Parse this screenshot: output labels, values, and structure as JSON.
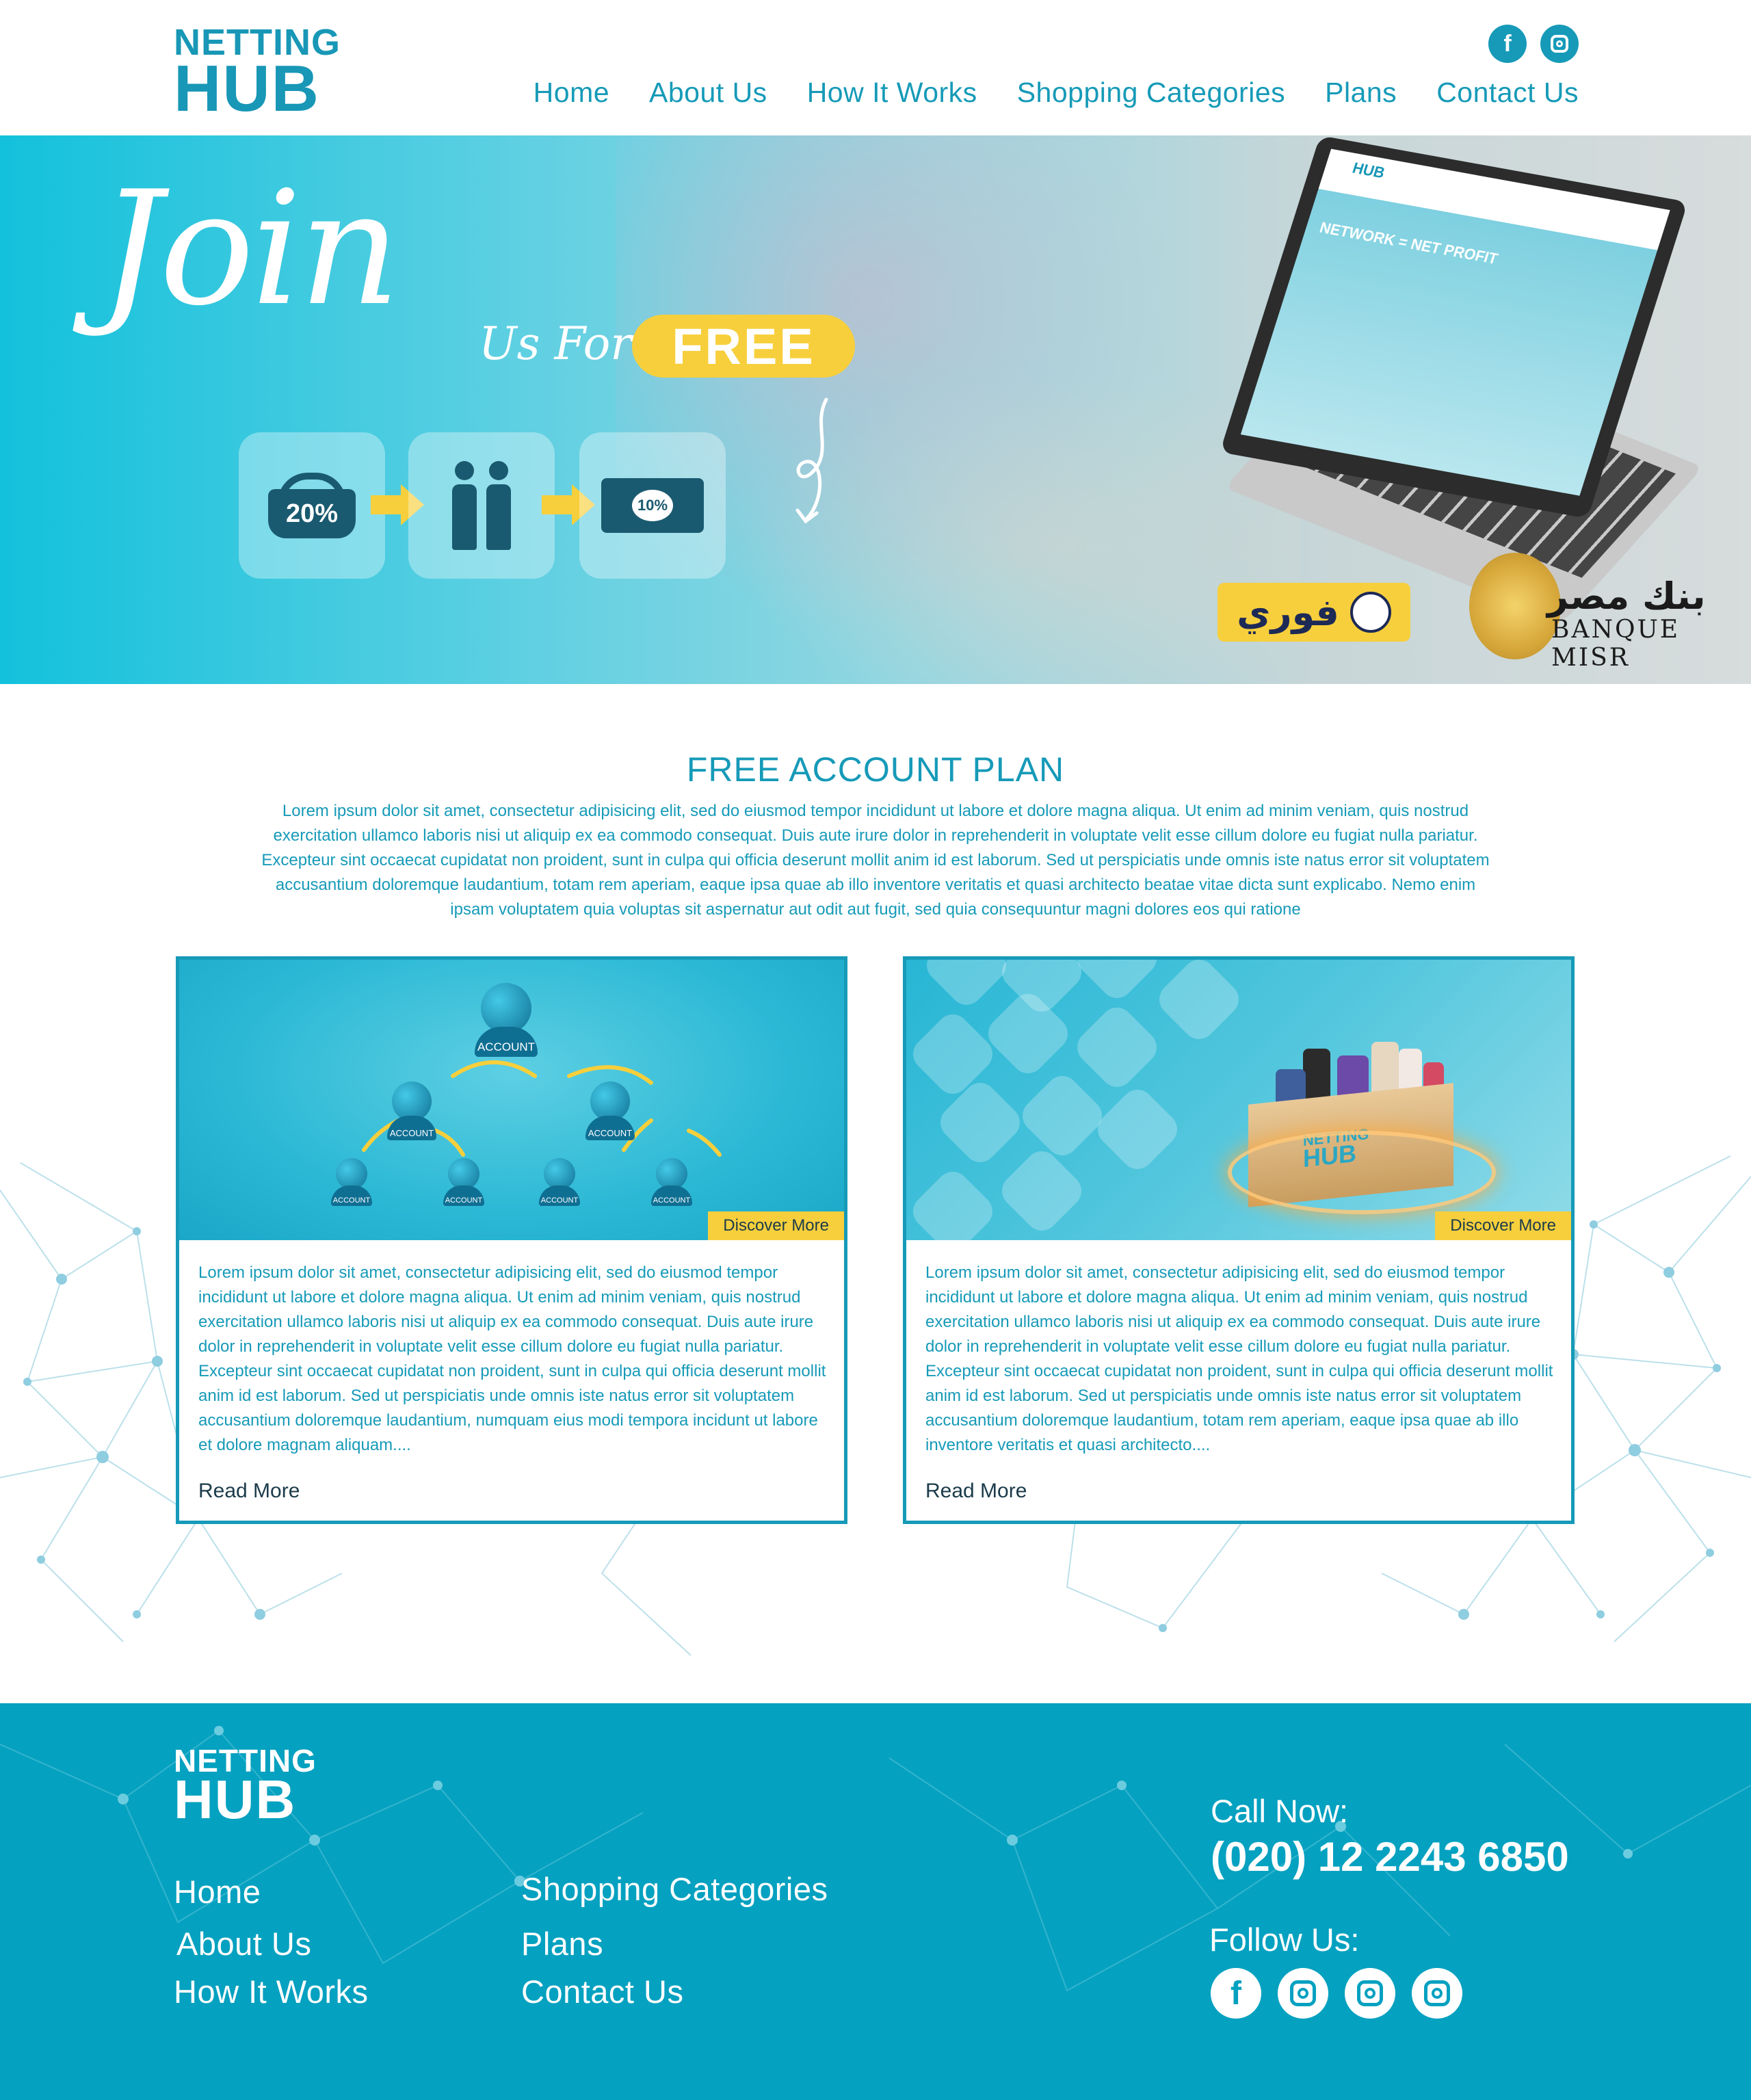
{
  "brand": {
    "logo_line1": "NETTING",
    "logo_line2": "HUB"
  },
  "header": {
    "nav": [
      "Home",
      "About Us",
      "How It Works",
      "Shopping Categories",
      "Plans",
      "Contact Us"
    ],
    "social_icons": [
      "facebook-icon",
      "instagram-icon"
    ]
  },
  "hero": {
    "headline": "Join",
    "subheadline": "Us For",
    "badge": "FREE",
    "steps": [
      {
        "icon": "shopping-basket-icon",
        "label": "20%"
      },
      {
        "icon": "handshake-icon",
        "label": ""
      },
      {
        "icon": "cash-icon",
        "label": "10%"
      }
    ],
    "partners": {
      "fawry": "فوري",
      "bank_arabic": "بنك مصر",
      "bank_english": "BANQUE MISR"
    },
    "laptop_screen": {
      "logo": "HUB",
      "text": "NETWORK = NET PROFIT"
    }
  },
  "plan": {
    "title": "FREE ACCOUNT PLAN",
    "description": "Lorem ipsum dolor sit amet, consectetur adipisicing elit, sed do eiusmod tempor incididunt ut labore et dolore magna aliqua. Ut enim ad minim veniam, quis nostrud exercitation ullamco laboris nisi ut aliquip ex ea commodo consequat. Duis aute irure dolor in reprehenderit in voluptate velit esse cillum dolore eu fugiat nulla pariatur. Excepteur sint occaecat cupidatat non proident, sunt in culpa qui officia deserunt mollit anim id est laborum. Sed ut perspiciatis unde omnis iste natus error sit voluptatem accusantium doloremque laudantium, totam rem aperiam, eaque ipsa quae ab illo inventore veritatis et quasi architecto beatae vitae dicta sunt explicabo. Nemo enim ipsam voluptatem quia voluptas sit aspernatur aut odit aut fugit, sed quia consequuntur magni dolores eos qui ratione"
  },
  "cards": [
    {
      "discover": "Discover More",
      "account_label": "ACCOUNT",
      "text": "Lorem ipsum dolor sit amet, consectetur adipisicing elit, sed do eiusmod tempor incididunt ut labore et dolore magna aliqua. Ut enim ad minim veniam, quis nostrud exercitation ullamco laboris nisi ut aliquip ex ea commodo consequat. Duis aute irure dolor in reprehenderit in voluptate velit esse cillum dolore eu fugiat nulla pariatur. Excepteur sint occaecat cupidatat non proident, sunt in culpa qui officia deserunt mollit anim id est laborum. Sed ut perspiciatis unde omnis iste natus error sit voluptatem accusantium doloremque laudantium, numquam eius modi tempora incidunt ut labore et dolore magnam aliquam....",
      "read_more": "Read More"
    },
    {
      "discover": "Discover More",
      "box_label_1": "NETTING",
      "box_label_2": "HUB",
      "text": "Lorem ipsum dolor sit amet, consectetur adipisicing elit, sed do eiusmod tempor incididunt ut labore et dolore magna aliqua. Ut enim ad minim veniam, quis nostrud exercitation ullamco laboris nisi ut aliquip ex ea commodo consequat. Duis aute irure dolor in reprehenderit in voluptate velit esse cillum dolore eu fugiat nulla pariatur. Excepteur sint occaecat cupidatat non proident, sunt in culpa qui officia deserunt mollit anim id est laborum. Sed ut perspiciatis unde omnis iste natus error sit voluptatem accusantium doloremque laudantium, totam rem aperiam, eaque ipsa quae ab illo inventore veritatis et quasi architecto....",
      "read_more": "Read More"
    }
  ],
  "footer": {
    "links_col1": [
      "Home",
      "About Us",
      "How It Works"
    ],
    "links_col2": [
      "Shopping Categories",
      "Plans",
      "Contact Us"
    ],
    "call_label": "Call Now:",
    "phone": "(020) 12 2243 6850",
    "follow_label": "Follow Us:",
    "social_icons": [
      "facebook-icon",
      "instagram-icon",
      "instagram-icon",
      "instagram-icon"
    ]
  },
  "colors": {
    "primary": "#169ab8",
    "footer": "#05a1c0",
    "accent": "#f7cf3c",
    "dark": "#1b3b4a"
  }
}
